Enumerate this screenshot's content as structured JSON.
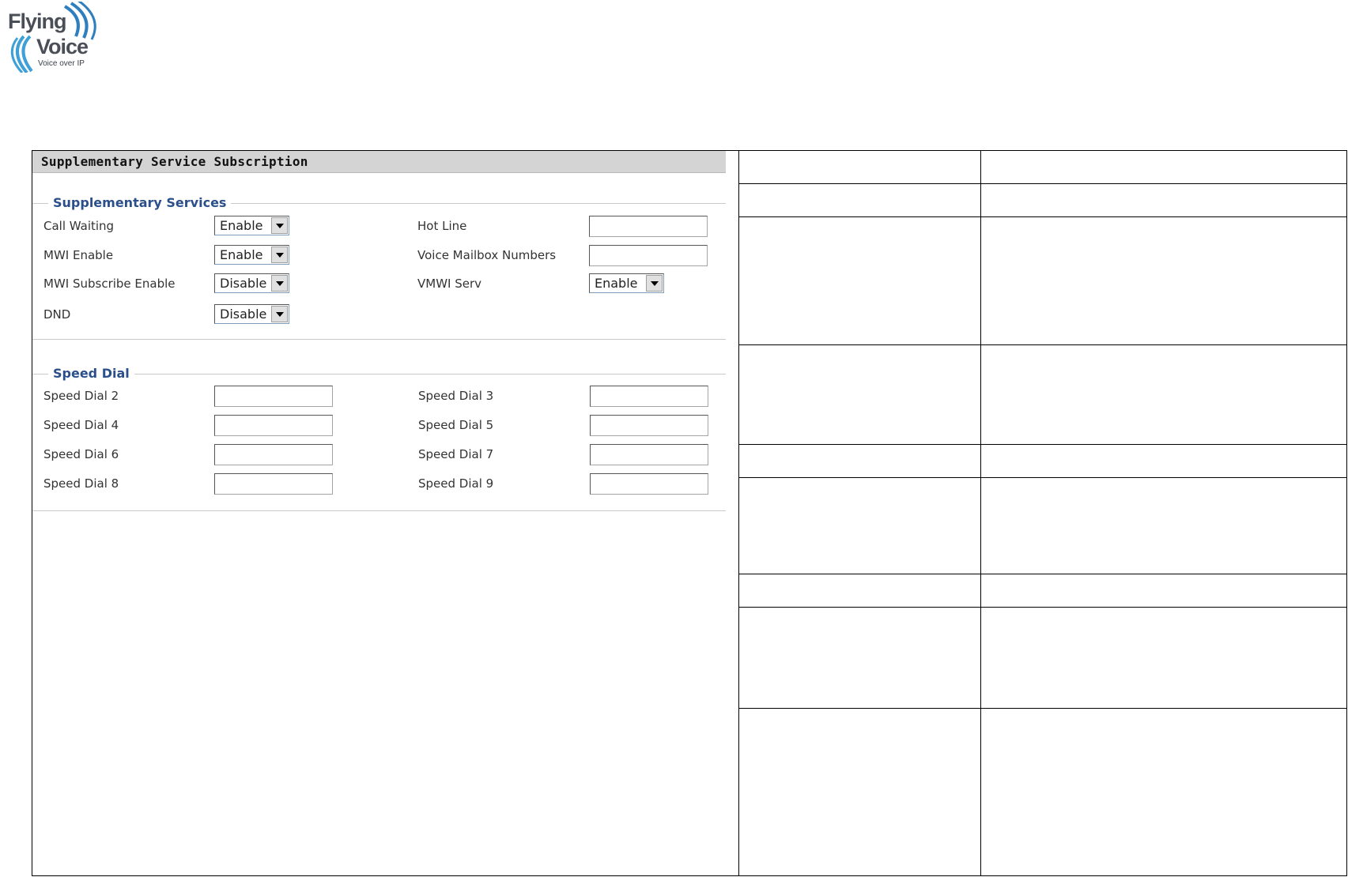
{
  "logo": {
    "line1": "Flying",
    "line2": "Voice",
    "tagline": "Voice over IP"
  },
  "panel": {
    "title": "Supplementary Service Subscription",
    "supplementary": {
      "legend": "Supplementary Services",
      "fields": [
        {
          "label": "Call Waiting",
          "type": "select",
          "value": "Enable"
        },
        {
          "label": "MWI Enable",
          "type": "select",
          "value": "Enable"
        },
        {
          "label": "MWI Subscribe Enable",
          "type": "select",
          "value": "Disable"
        },
        {
          "label": "DND",
          "type": "select",
          "value": "Disable"
        },
        {
          "label": "Hot Line",
          "type": "text",
          "value": ""
        },
        {
          "label": "Voice Mailbox Numbers",
          "type": "text",
          "value": ""
        },
        {
          "label": "VMWI Serv",
          "type": "select",
          "value": "Enable"
        }
      ]
    },
    "speed_dial": {
      "legend": "Speed Dial",
      "fields": [
        {
          "label": "Speed Dial 2",
          "value": ""
        },
        {
          "label": "Speed Dial 3",
          "value": ""
        },
        {
          "label": "Speed Dial 4",
          "value": ""
        },
        {
          "label": "Speed Dial 5",
          "value": ""
        },
        {
          "label": "Speed Dial 6",
          "value": ""
        },
        {
          "label": "Speed Dial 7",
          "value": ""
        },
        {
          "label": "Speed Dial 8",
          "value": ""
        },
        {
          "label": "Speed Dial 9",
          "value": ""
        }
      ]
    }
  },
  "colors": {
    "legend": "#2b4f8a",
    "title_bar": "#d4d4d4",
    "logo_blue": "#2f7fbf"
  }
}
